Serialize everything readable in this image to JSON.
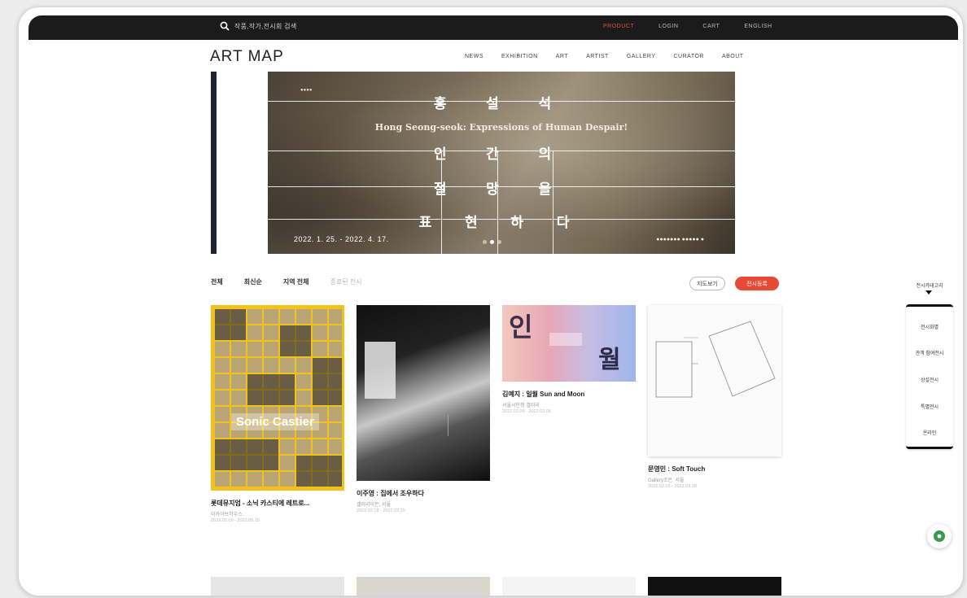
{
  "topbar": {
    "search_placeholder": "작품,작가,전시회 검색",
    "links": [
      {
        "label": "PRODUCT",
        "active": true
      },
      {
        "label": "LOGIN",
        "active": false
      },
      {
        "label": "CART",
        "active": false
      },
      {
        "label": "ENGLISH",
        "active": false
      }
    ]
  },
  "header": {
    "logo": "ART MAP",
    "nav": [
      "NEWS",
      "EXHIBITION",
      "ART",
      "ARTIST",
      "GALLERY",
      "CURATOR",
      "ABOUT"
    ]
  },
  "banner": {
    "kor_line1": "홍 설 석",
    "english_title": "Hong Seong-seok: Expressions of Human Despair!",
    "kor_line2": "인 간 의",
    "kor_line3": "절 망 을",
    "kor_line4": "표 현 하 다",
    "date": "2022. 1. 25. - 2022. 4. 17.",
    "slide_count": 3,
    "active_slide": 1
  },
  "filters": {
    "items": [
      "전체",
      "최신순",
      "지역 전체",
      "종료된 전시"
    ],
    "outline_button": "지도보기",
    "red_button": "전시등록"
  },
  "cards": [
    {
      "title": "롯데뮤지엄 - 소닉 카스티에 레트로...",
      "subtitle": "아카이브하우스",
      "date": "2022.02.09 - 2022.05.15",
      "poster_text": "Sonic Castier"
    },
    {
      "title": "이주영 : 집에서 조우하다",
      "subtitle": "갤러리이든, 서울",
      "date": "2022.02.18 - 2022.03.15"
    },
    {
      "title": "김예지 : 일월 Sun and Moon",
      "subtitle": "서울시민청 갤러리",
      "date": "2022.02.09 - 2022.03.06",
      "poster_chars": [
        "인",
        "월"
      ]
    },
    {
      "title": "문영민 : Soft Touch",
      "subtitle": "Gallery조은, 서울",
      "date": "2022.02.18 - 2022.03.20"
    }
  ],
  "side_widget": {
    "header": "전시카테고리",
    "items": [
      "전시회별",
      "관객 참여전시",
      "상설전시",
      "특별전시",
      "온라인"
    ]
  },
  "colors": {
    "accent_red": "#e64a35",
    "topbar_bg": "#1b1b1b",
    "poster_yellow": "#f2c21b"
  }
}
